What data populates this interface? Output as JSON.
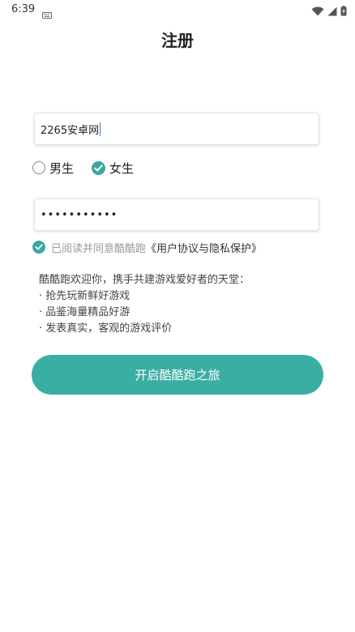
{
  "status_bar": {
    "time": "6:39"
  },
  "header": {
    "title": "注册"
  },
  "form": {
    "username_value": "2265安卓网",
    "gender": {
      "male_label": "男生",
      "female_label": "女生",
      "selected": "女生"
    },
    "password_masked": "•••••••••••",
    "agreement": {
      "prefix": "已阅读并同意酷酷跑",
      "link": "《用户协议与隐私保护》"
    }
  },
  "intro": {
    "headline": "酷酷跑欢迎你，携手共建游戏爱好者的天堂：",
    "bullets": [
      "· 抢先玩新鲜好游戏",
      "· 品鉴海量精品好游",
      "· 发表真实，客观的游戏评价"
    ]
  },
  "cta": {
    "label": "开启酷酷跑之旅"
  },
  "colors": {
    "accent": "#3aaea3"
  }
}
